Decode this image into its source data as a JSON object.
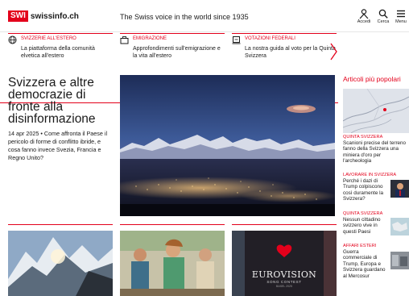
{
  "header": {
    "logo_mark": "SWI",
    "logo_text": "swissinfo.ch",
    "tagline": "The Swiss voice in the world since 1935",
    "login_label": "Accedi",
    "search_label": "Cerca",
    "menu_label": "Menu"
  },
  "strip": {
    "items": [
      {
        "category": "SVIZZERIE ALL'ESTERO",
        "text": "La piattaforma della comunità elvetica all'estero",
        "icon": "globe-icon"
      },
      {
        "category": "EMIGRAZIONE",
        "text": "Approfondimenti sull'emigrazione e la vita all'estero",
        "icon": "suitcase-icon"
      },
      {
        "category": "VOTAZIONI FEDERALI",
        "text": "La nostra guida al voto per la Quinta Svizzera",
        "icon": "ballot-icon"
      }
    ]
  },
  "lead": {
    "title": "Svizzera e altre democrazie di fronte alla disinformazione",
    "date": "14 apr 2025",
    "separator": "•",
    "text": "Come affronta il Paese il pericolo di forme di conflitto ibride, e cosa fanno invece Svezia, Francia e Regno Unito?"
  },
  "sidebar": {
    "title": "Articoli più popolari",
    "items": [
      {
        "category": "QUINTA SVIZZERA",
        "text": "Scanioni precise del terreno fanno della Svizzera una miniera d'oro per l'archeologia"
      },
      {
        "category": "LAVORARE IN SVIZZERA",
        "text": "Perché i dazi di Trump colpiscono così duramente la Svizzera?"
      },
      {
        "category": "QUINTA SVIZZERA",
        "text": "Nessun cittadino svizzero vive in questi Paesi"
      },
      {
        "category": "AFFARI ESTERI",
        "text": "Guerra commerciale di Trump, Europa e Svizzera guardano al Mercosur"
      }
    ]
  },
  "bottom": {
    "eurovision_title": "EUROVISION",
    "eurovision_sub": "SONG CONTEST",
    "eurovision_city": "BASEL 2025"
  },
  "colors": {
    "accent": "#e3001b",
    "text": "#1a1a1a"
  }
}
